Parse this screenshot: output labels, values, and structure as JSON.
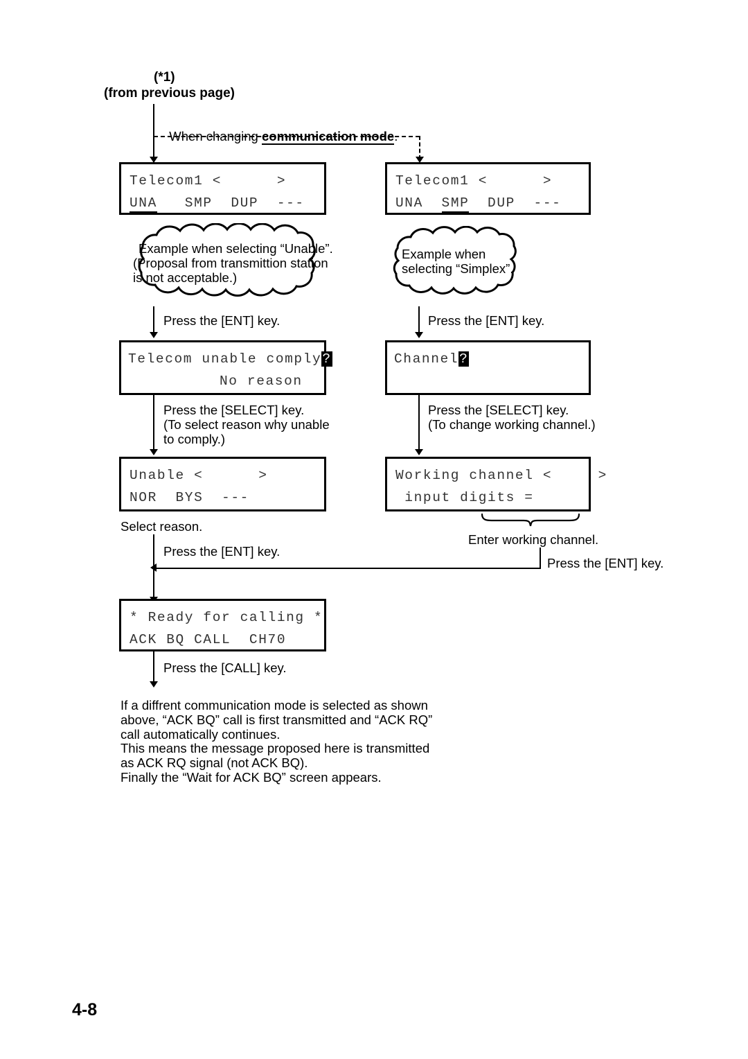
{
  "page": {
    "number": "4-8"
  },
  "header": {
    "ref_mark": "(*1)",
    "from_prev": "(from previous page)"
  },
  "intro": {
    "prefix": "When changing ",
    "bold": "communication mode",
    "suffix": "."
  },
  "screens": {
    "telecom_una": {
      "line1": "Telecom1 <      >",
      "line2_pre": "",
      "line2_opt1": "UNA",
      "line2_mid": "   SMP  DUP  ---",
      "underline": "UNA"
    },
    "telecom_smp": {
      "line1": "Telecom1 <      >",
      "line2_pre": "UNA  ",
      "line2_opt2": "SMP",
      "line2_post": "  DUP  ---",
      "underline": "SMP"
    },
    "unable_comply": {
      "line1": "Telecom unable comply",
      "cursor": "?",
      "line2": "No reason"
    },
    "channel": {
      "line1": "Channel",
      "cursor": "?",
      "line2": ""
    },
    "unable_reason": {
      "line1": "Unable <      >",
      "line2": "NOR  BYS  ---"
    },
    "working_channel": {
      "line1": "Working channel <     >",
      "line2": " input digits ="
    },
    "ready": {
      "line1": "* Ready for calling *",
      "line2": "ACK BQ CALL  CH70"
    }
  },
  "clouds": {
    "unable": {
      "line1": "Example when selecting “Unable”.",
      "line2": "(Proposal from transmittion station",
      "line3": "is not acceptable.)"
    },
    "simplex": {
      "line1": "Example when",
      "line2": "selecting “Simplex”."
    }
  },
  "annotations": {
    "ent_left_1": "Press the [ENT] key.",
    "ent_right_1": "Press the [ENT] key.",
    "select_left_1": "Press the [SELECT] key.",
    "select_left_2": "(To select reason why unable",
    "select_left_3": "to comply.)",
    "select_right_1": "Press the [SELECT] key.",
    "select_right_2": "(To change working channel.)",
    "select_reason": "Select reason.",
    "ent_left_2": "Press the [ENT] key.",
    "enter_working_channel": "Enter working channel.",
    "ent_right_2": "Press the [ENT] key.",
    "call_key": "Press the [CALL] key."
  },
  "footnote": {
    "line1": "If a diffrent communication mode is selected as shown",
    "line2": "above, “ACK BQ” call is first transmitted and “ACK RQ”",
    "line3": "call automatically continues.",
    "line4": "This means the message proposed here is transmitted",
    "line5": "as ACK RQ signal (not ACK BQ).",
    "line6": "Finally the “Wait for ACK BQ” screen appears."
  }
}
